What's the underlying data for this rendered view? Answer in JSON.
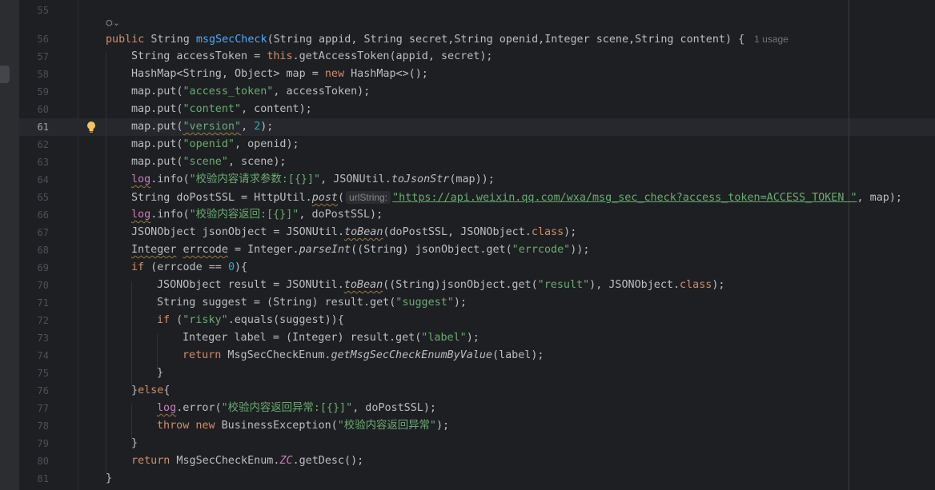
{
  "editor": {
    "usage_hint": "1 usage",
    "param_hint": "urlString:",
    "lines": [
      {
        "n": "55"
      },
      {
        "n": "56"
      },
      {
        "n": "57"
      },
      {
        "n": "58"
      },
      {
        "n": "59"
      },
      {
        "n": "60"
      },
      {
        "n": "61"
      },
      {
        "n": "62"
      },
      {
        "n": "63"
      },
      {
        "n": "64"
      },
      {
        "n": "65"
      },
      {
        "n": "66"
      },
      {
        "n": "67"
      },
      {
        "n": "68"
      },
      {
        "n": "69"
      },
      {
        "n": "70"
      },
      {
        "n": "71"
      },
      {
        "n": "72"
      },
      {
        "n": "73"
      },
      {
        "n": "74"
      },
      {
        "n": "75"
      },
      {
        "n": "76"
      },
      {
        "n": "77"
      },
      {
        "n": "78"
      },
      {
        "n": "79"
      },
      {
        "n": "80"
      },
      {
        "n": "81"
      }
    ],
    "code": {
      "l56": {
        "kw_public": "public",
        "type": " String ",
        "name": "msgSecCheck",
        "params": "(String appid, String secret,String openid,Integer scene,String content) {"
      },
      "l57": {
        "a": "String accessToken = ",
        "kw": "this",
        "b": ".getAccessToken(appid, secret);"
      },
      "l58": {
        "a": "HashMap<String, Object> map = ",
        "kw": "new",
        "b": " HashMap<>();"
      },
      "l59": {
        "a": "map.put(",
        "s": "\"access_token\"",
        "b": ", accessToken);"
      },
      "l60": {
        "a": "map.put(",
        "s": "\"content\"",
        "b": ", content);"
      },
      "l61": {
        "a": "map.put(",
        "s": "\"version\"",
        "b": ", ",
        "num": "2",
        "c": ");"
      },
      "l62": {
        "a": "map.put(",
        "s": "\"openid\"",
        "b": ", openid);"
      },
      "l63": {
        "a": "map.put(",
        "s": "\"scene\"",
        "b": ", scene);"
      },
      "l64": {
        "log": "log",
        "a": ".info(",
        "s": "\"校验内容请求参数:[{}]\"",
        "b": ", JSONUtil.",
        "m": "toJsonStr",
        "c": "(map));"
      },
      "l65": {
        "a": "String doPostSSL = HttpUtil.",
        "m": "post",
        "b": "(",
        "s": "\"https://api.weixin.qq.com/wxa/msg_sec_check?access_token=ACCESS_TOKEN \"",
        "c": ", map);"
      },
      "l66": {
        "log": "log",
        "a": ".info(",
        "s": "\"校验内容返回:[{}]\"",
        "b": ", doPostSSL);"
      },
      "l67": {
        "a": "JSONObject jsonObject = JSONUtil.",
        "m": "toBean",
        "b": "(doPostSSL, JSONObject.",
        "kw": "class",
        "c": ");"
      },
      "l68": {
        "t1": "Integer",
        "sp": " ",
        "t2": "errcode",
        "a": " = Integer.",
        "m": "parseInt",
        "b": "((String) jsonObject.get(",
        "s": "\"errcode\"",
        "c": "));"
      },
      "l69": {
        "kw": "if",
        "a": " (errcode == ",
        "num": "0",
        "b": "){"
      },
      "l70": {
        "a": "JSONObject result = JSONUtil.",
        "m": "toBean",
        "b": "((String)jsonObject.get(",
        "s": "\"result\"",
        "c": "), JSONObject.",
        "kw": "class",
        "d": ");"
      },
      "l71": {
        "a": "String suggest = (String) result.get(",
        "s": "\"suggest\"",
        "b": ");"
      },
      "l72": {
        "kw": "if",
        "a": " (",
        "s": "\"risky\"",
        "b": ".equals(suggest)){"
      },
      "l73": {
        "a": "Integer label = (Integer) result.get(",
        "s": "\"label\"",
        "b": ");"
      },
      "l74": {
        "kw": "return",
        "a": " MsgSecCheckEnum.",
        "m": "getMsgSecCheckEnumByValue",
        "b": "(label);"
      },
      "l75": {
        "a": "}"
      },
      "l76": {
        "a": "}",
        "kw": "else",
        "b": "{"
      },
      "l77": {
        "log": "log",
        "a": ".error(",
        "s": "\"校验内容返回异常:[{}]\"",
        "b": ", doPostSSL);"
      },
      "l78": {
        "kw1": "throw",
        "sp": " ",
        "kw2": "new",
        "a": " BusinessException(",
        "s": "\"校验内容返回异常\"",
        "b": ");"
      },
      "l79": {
        "a": "}"
      },
      "l80": {
        "kw": "return",
        "a": " MsgSecCheckEnum.",
        "f": "ZC",
        "b": ".getDesc();"
      },
      "l81": {
        "a": "}"
      }
    }
  }
}
